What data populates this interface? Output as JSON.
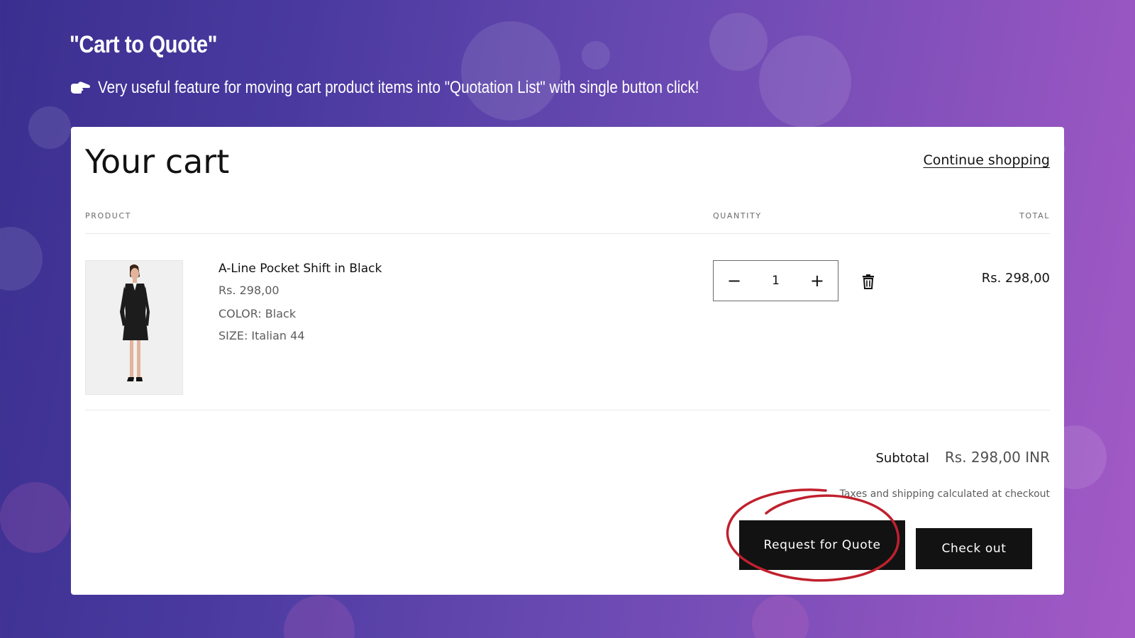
{
  "promo": {
    "title": "\"Cart to Quote\"",
    "subtitle": "Very useful feature for moving cart product items into \"Quotation List\" with single button click!",
    "hand_icon": "pointing-hand-icon"
  },
  "cart": {
    "title": "Your cart",
    "continue_label": "Continue shopping",
    "headers": {
      "product": "PRODUCT",
      "quantity": "QUANTITY",
      "total": "TOTAL"
    },
    "item": {
      "name": "A-Line Pocket Shift in Black",
      "price": "Rs. 298,00",
      "color": "COLOR: Black",
      "size": "SIZE: Italian 44",
      "quantity": "1",
      "minus": "−",
      "plus": "+",
      "line_total": "Rs. 298,00",
      "delete_icon": "trash-icon"
    },
    "subtotal_label": "Subtotal",
    "subtotal_value": "Rs. 298,00 INR",
    "tax_note": "Taxes and shipping calculated at checkout",
    "request_quote_label": "Request for Quote",
    "checkout_label": "Check out"
  },
  "colors": {
    "button_bg": "#121212",
    "highlight_circle": "#c0202d"
  }
}
